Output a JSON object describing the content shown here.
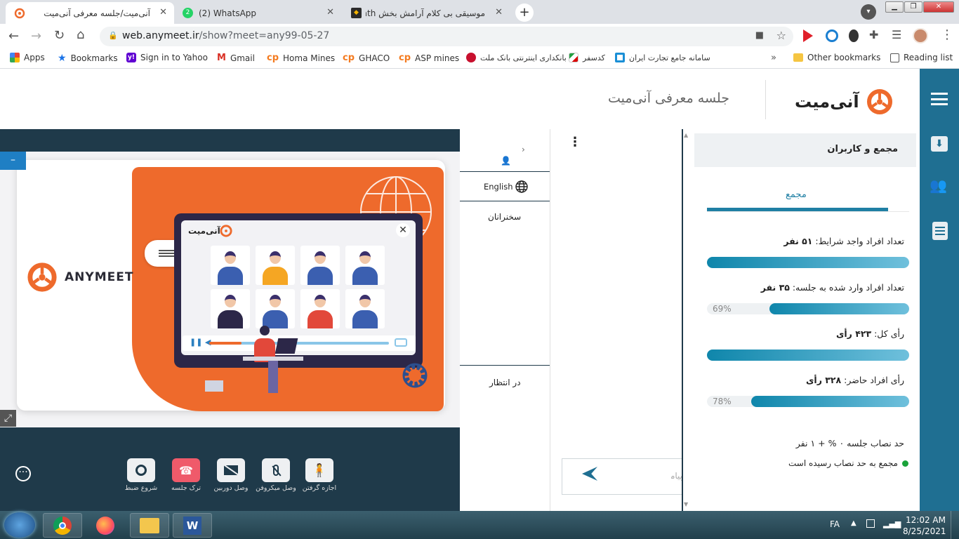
{
  "browser": {
    "tabs": [
      {
        "title": "آنی‌میت/جلسه معرفی آنی‌میت",
        "active": true
      },
      {
        "title": "(2) WhatsApp",
        "badge": "2"
      },
      {
        "title": "موسیقی بی کلام آرامش بخش Path"
      }
    ],
    "url_host": "web.anymeet.ir",
    "url_path": "/show?meet=any99-05-27",
    "bookmarks": [
      {
        "label": "Apps",
        "icon": "apps-grid-icon"
      },
      {
        "label": "Bookmarks",
        "icon": "star-icon"
      },
      {
        "label": "Sign in to Yahoo",
        "icon": "yahoo-icon"
      },
      {
        "label": "Gmail",
        "icon": "gmail-icon"
      },
      {
        "label": "Homa Mines",
        "icon": "cp-icon"
      },
      {
        "label": "GHACO",
        "icon": "cp-icon"
      },
      {
        "label": "ASP mines",
        "icon": "cp-icon"
      },
      {
        "label": "بانکداری اینترنتی بانک ملت",
        "icon": "bank-icon"
      },
      {
        "label": "کدسفر",
        "icon": "flag-icon"
      },
      {
        "label": "سامانه جامع تجارت ایران",
        "icon": "portal-icon"
      }
    ],
    "other_bookmarks": "Other bookmarks",
    "reading_list": "Reading list",
    "more": "»"
  },
  "app": {
    "logo_text": "آنی‌میت",
    "meeting_title": "جلسه معرفی آنی‌میت",
    "slide": {
      "brand": "ANYMEET",
      "window_logo": "آنی‌میت"
    },
    "minimize": "–"
  },
  "users_panel": {
    "chevron": "›",
    "language": "English",
    "speakers": "سخنرانان",
    "waiting": "در انتظار"
  },
  "chat_panel": {
    "menu": "⋮",
    "input_placeholder": "پیامی",
    "send": "send"
  },
  "stats_panel": {
    "title": "مجمع و کاربران",
    "tab": "مجمع",
    "rows": [
      {
        "label": "تعداد افراد واجد شرایط:",
        "value": "۵۱ نفر",
        "fraction": 1.0
      },
      {
        "label": "تعداد افراد وارد شده به جلسه:",
        "value": "۳۵ نفر",
        "percent": "69%",
        "fraction": 0.69
      },
      {
        "label": "رأی کل:",
        "value": "۴۲۳ رأی",
        "fraction": 1.0
      },
      {
        "label": "رأی افراد حاضر:",
        "value": "۳۲۸ رأی",
        "percent": "78%",
        "fraction": 0.78
      }
    ],
    "quorum": "حد نصاب جلسه ۰ % + ۱ نفر",
    "quorum_reached": "مجمع به حد نصاب رسیده است",
    "status_color": "#1aa33a"
  },
  "controls": [
    {
      "label": "شروع ضبط",
      "icon": "record-icon"
    },
    {
      "label": "ترک جلسه",
      "icon": "hangup-icon"
    },
    {
      "label": "وصل دوربین",
      "icon": "camera-off-icon"
    },
    {
      "label": "وصل میکروفن",
      "icon": "mic-off-icon"
    },
    {
      "label": "اجازه گرفتن",
      "icon": "raise-hand-icon"
    }
  ],
  "taskbar": {
    "lang": "FA",
    "time": "12:02 AM",
    "date": "8/25/2021"
  },
  "colors": {
    "brand_orange": "#ee6a2c",
    "accent_blue": "#1f6f92",
    "leave_red": "#ef5a6a"
  }
}
